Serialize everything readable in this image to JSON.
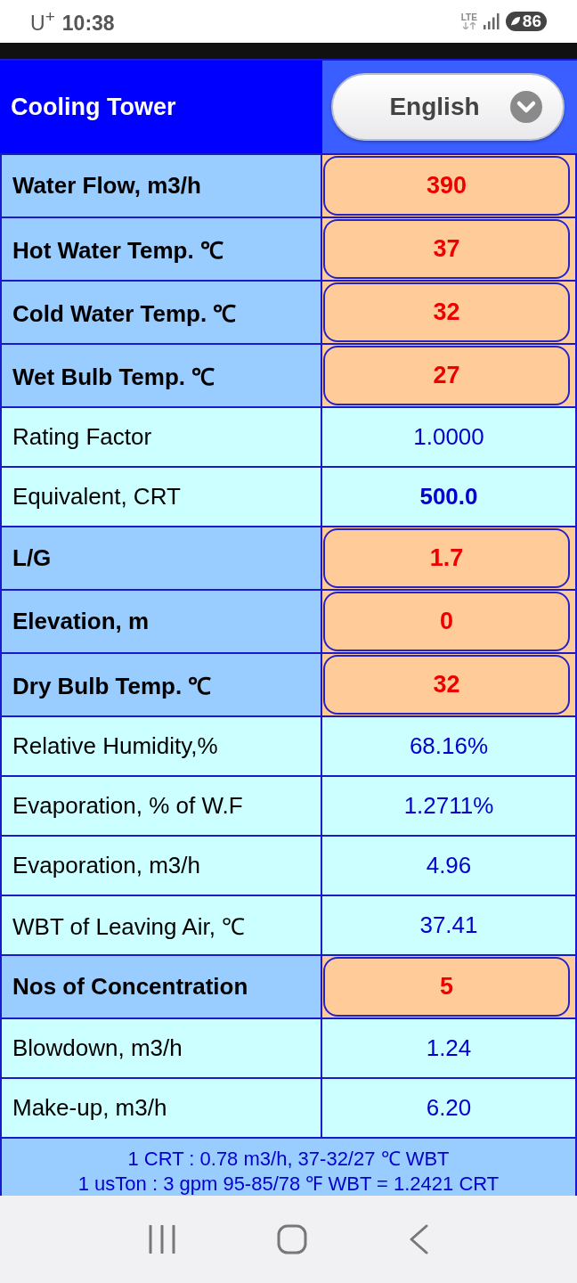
{
  "status_bar": {
    "carrier": "U$^{+}$",
    "time": "10:38",
    "network": "LTE",
    "battery": "86"
  },
  "header": {
    "title": "Cooling Tower",
    "language_select": {
      "value": "English"
    }
  },
  "rows": [
    {
      "kind": "input",
      "label": "Water Flow, m3/h",
      "value": "390"
    },
    {
      "kind": "input",
      "label": "Hot Water Temp. ℃",
      "value": "37"
    },
    {
      "kind": "input",
      "label": "Cold Water Temp. ℃",
      "value": "32"
    },
    {
      "kind": "input",
      "label": "Wet Bulb Temp. ℃",
      "value": "27"
    },
    {
      "kind": "output",
      "label": "Rating Factor",
      "value": "1.0000"
    },
    {
      "kind": "result",
      "label": "Equivalent, CRT",
      "value": "500.0"
    },
    {
      "kind": "input",
      "label": "L/G",
      "value": "1.7"
    },
    {
      "kind": "input",
      "label": "Elevation, m",
      "value": "0"
    },
    {
      "kind": "input",
      "label": "Dry Bulb Temp. ℃",
      "value": "32"
    },
    {
      "kind": "output",
      "label": "Relative Humidity,%",
      "value": "68.16%"
    },
    {
      "kind": "output",
      "label": "Evaporation, % of W.F",
      "value": "1.2711%"
    },
    {
      "kind": "output",
      "label": "Evaporation, m3/h",
      "value": "4.96"
    },
    {
      "kind": "output",
      "label": "WBT of Leaving Air, ℃",
      "value": "37.41"
    },
    {
      "kind": "input",
      "label": "Nos of Concentration",
      "value": "5"
    },
    {
      "kind": "output",
      "label": "Blowdown, m3/h",
      "value": "1.24"
    },
    {
      "kind": "output",
      "label": "Make-up, m3/h",
      "value": "6.20"
    }
  ],
  "footer": {
    "lines": [
      "1 CRT : 0.78 m3/h, 37-32/27 ℃ WBT",
      "1 usTon : 3 gpm 95-85/78 ℉ WBT = 1.2421 CRT"
    ]
  }
}
